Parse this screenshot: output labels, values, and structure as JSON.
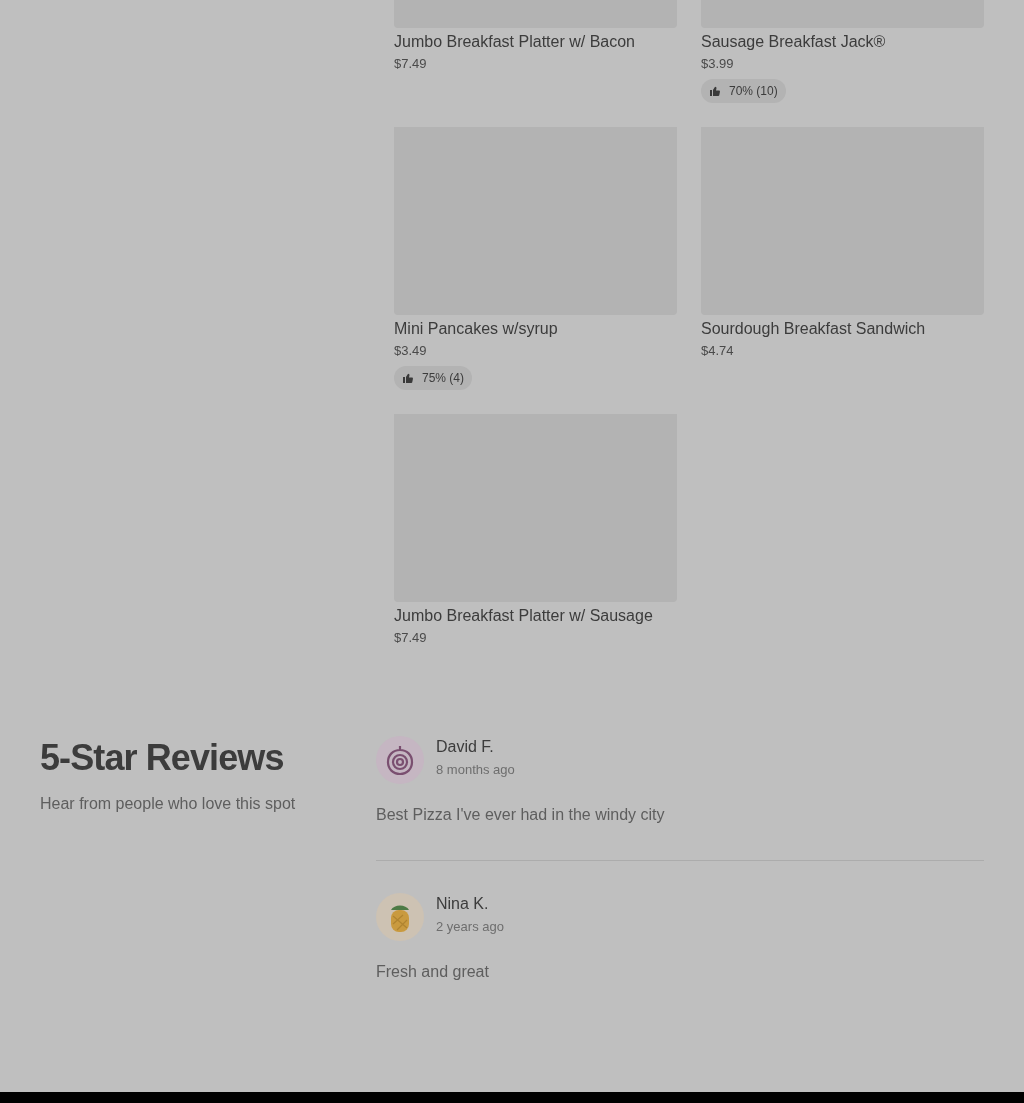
{
  "menu_items": [
    {
      "name": "Jumbo Breakfast Platter w/ Bacon",
      "price": "$7.49"
    },
    {
      "name": "Sausage Breakfast Jack®",
      "price": "$3.99",
      "rating": "70% (10)"
    },
    {
      "name": "Mini Pancakes w/syrup",
      "price": "$3.49",
      "rating": "75% (4)"
    },
    {
      "name": "Sourdough Breakfast Sandwich",
      "price": "$4.74"
    },
    {
      "name": "Jumbo Breakfast Platter w/ Sausage",
      "price": "$7.49"
    }
  ],
  "reviews_section": {
    "title": "5-Star Reviews",
    "subtitle": "Hear from people who love this spot"
  },
  "reviews": [
    {
      "name": "David F.",
      "time": "8 months ago",
      "text": "Best Pizza I've ever had in the windy city"
    },
    {
      "name": "Nina K.",
      "time": "2 years ago",
      "text": "Fresh and great"
    }
  ]
}
